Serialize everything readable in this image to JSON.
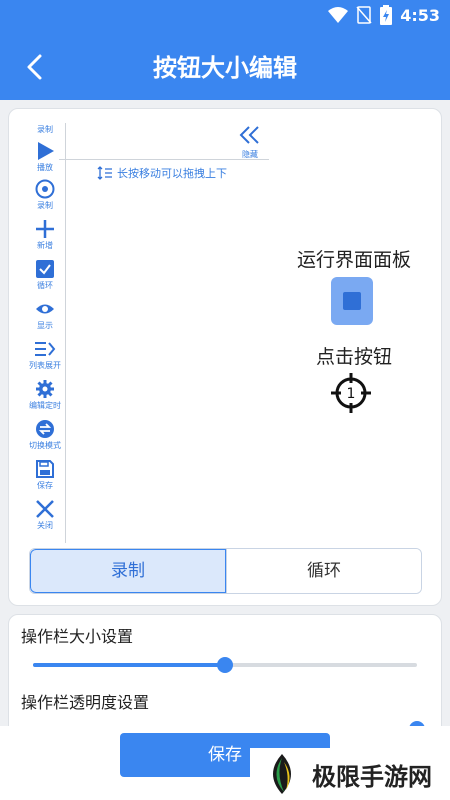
{
  "status_bar": {
    "time": "4:53",
    "icons": [
      "wifi-icon",
      "no-signal-icon",
      "battery-charging-icon"
    ]
  },
  "app_bar": {
    "title": "按钮大小编辑",
    "back_icon": "chevron-left-icon"
  },
  "toolbar": {
    "items": [
      {
        "label": "录制",
        "icon": "none"
      },
      {
        "label": "播放",
        "icon": "play-icon"
      },
      {
        "label": "录制",
        "icon": "record-icon"
      },
      {
        "label": "新增",
        "icon": "plus-icon"
      },
      {
        "label": "循环",
        "icon": "check-box-icon"
      },
      {
        "label": "显示",
        "icon": "eye-icon"
      },
      {
        "label": "列表展开",
        "icon": "list-expand-icon"
      },
      {
        "label": "编辑定时",
        "icon": "gear-icon"
      },
      {
        "label": "切换模式",
        "icon": "swap-icon"
      },
      {
        "label": "保存",
        "icon": "save-icon"
      },
      {
        "label": "关闭",
        "icon": "close-icon"
      }
    ],
    "collapse_label": "隐藏",
    "hint": "长按移动可以拖拽上下"
  },
  "panel": {
    "run_title": "运行界面面板",
    "click_title": "点击按钮",
    "target_number": "1"
  },
  "tabs": [
    {
      "label": "录制",
      "active": true
    },
    {
      "label": "循环",
      "active": false
    }
  ],
  "settings": {
    "size_label": "操作栏大小设置",
    "size_value": 0.5,
    "opacity_label": "操作栏透明度设置",
    "opacity_value": 1.0
  },
  "save_label": "保存",
  "watermark": {
    "text": "极限手游网"
  },
  "colors": {
    "primary": "#3a86f0",
    "accent_light": "#dbe8fb"
  }
}
